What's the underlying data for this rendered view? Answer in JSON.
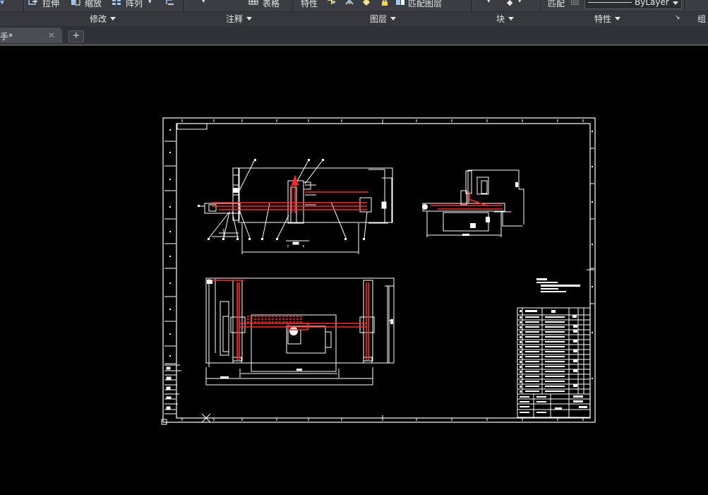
{
  "ribbon": {
    "row1": {
      "stretch": "拉伸",
      "scale": "缩放",
      "array": "阵列",
      "table": "表格",
      "properties": "特性",
      "match_layer": "匹配图层",
      "match": "匹配",
      "bylayer": "ByLayer"
    },
    "panels": {
      "modify": "修改",
      "annotation": "注释",
      "layers": "图层",
      "block": "块",
      "properties": "特性",
      "groups": "组"
    }
  },
  "tabs": {
    "active_label": "手*",
    "close_glyph": "✕",
    "new_tab_glyph": "+"
  },
  "colors": {
    "ribbon_bg": "#3a3d42",
    "canvas_bg": "#000000",
    "line_white": "#ffffff",
    "line_red": "#ff2020"
  },
  "icons": [
    "stretch-icon",
    "scale-icon",
    "array-icon",
    "table-icon",
    "layer-icon",
    "close-icon",
    "plus-icon",
    "ucs-icon"
  ]
}
